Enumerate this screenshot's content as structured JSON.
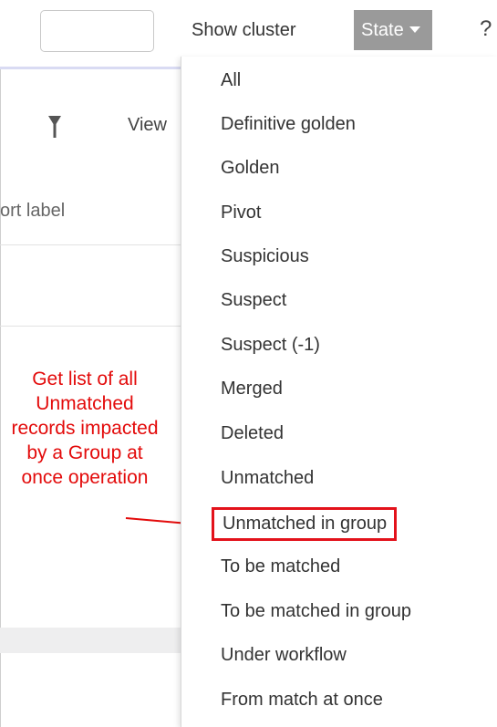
{
  "toolbar": {
    "search_value": "",
    "show_cluster_label": "Show cluster",
    "state_label": "State",
    "help_label": "?"
  },
  "background": {
    "view_label": "View",
    "sort_label": "ort label"
  },
  "state_menu": {
    "items": [
      "All",
      "Definitive golden",
      "Golden",
      "Pivot",
      "Suspicious",
      "Suspect",
      "Suspect (-1)",
      "Merged",
      "Deleted",
      "Unmatched",
      "Unmatched in group",
      "To be matched",
      "To be matched in group",
      "Under workflow",
      "From match at once"
    ],
    "highlighted_item": "Unmatched in group"
  },
  "annotation": {
    "text": "Get list of all Unmatched records impacted by a Group at once operation",
    "color": "#e30b0b"
  },
  "colors": {
    "state_button_bg": "#9a9a9a",
    "highlight_border": "#e3121b",
    "toolbar_underline": "#d9dbf3"
  }
}
